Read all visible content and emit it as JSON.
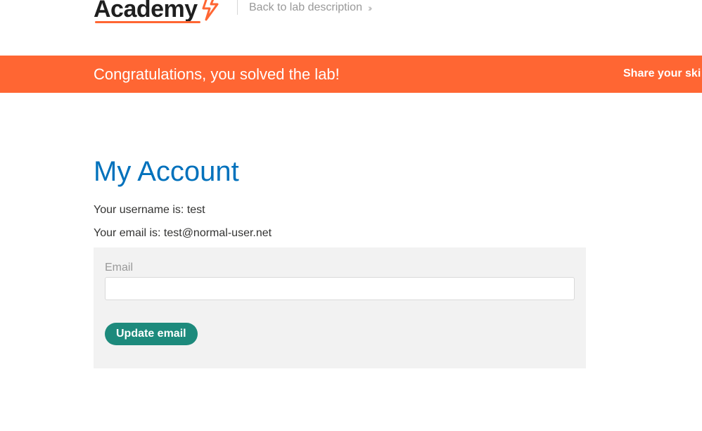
{
  "header": {
    "logo_text": "Academy",
    "back_link": "Back to lab description"
  },
  "banner": {
    "title": "Congratulations, you solved the lab!",
    "share": "Share your ski"
  },
  "account": {
    "heading": "My Account",
    "username_line": "Your username is: test",
    "email_line": "Your email is: test@normal-user.net"
  },
  "form": {
    "email_label": "Email",
    "email_value": "",
    "submit_label": "Update email"
  },
  "colors": {
    "brand_orange": "#ff6633",
    "heading_blue": "#0071bc",
    "button_teal": "#1d8a7c"
  }
}
